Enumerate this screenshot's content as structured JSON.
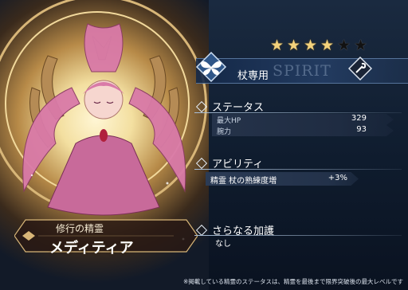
{
  "rarity": {
    "stars_filled": 4,
    "stars_total": 6
  },
  "weapon": {
    "label": "杖専用",
    "watermark": "SPIRIT",
    "emblem_icon": "butterfly-icon",
    "class_icon": "staff-class-icon"
  },
  "status": {
    "title": "ステータス",
    "rows": [
      {
        "name": "最大HP",
        "value": "329"
      },
      {
        "name": "腕力",
        "value": "93"
      }
    ]
  },
  "ability": {
    "title": "アビリティ",
    "rows": [
      {
        "name": "精霊 杖の熟練度増",
        "value": "+3%"
      }
    ]
  },
  "bonus": {
    "title": "さらなる加護",
    "value": "なし"
  },
  "character": {
    "subtitle": "修行の精霊",
    "name": "メディティア"
  },
  "footnote": "※掲載している精霊のステータスは、精霊を最後まで限界突破後の最大レベルです",
  "colors": {
    "accent_gold": "#d8b678",
    "panel_blue": "#1f2c42",
    "hair_pink": "#d97aa8"
  }
}
